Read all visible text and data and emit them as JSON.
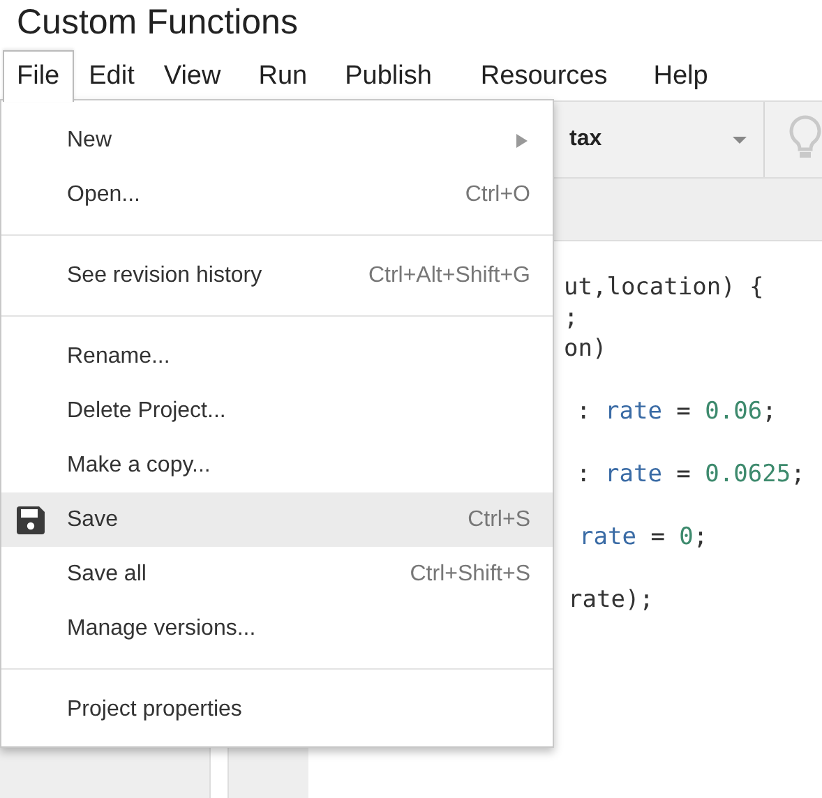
{
  "window": {
    "title": "Custom Functions"
  },
  "menu_bar": [
    {
      "label": "File",
      "selected": true
    },
    {
      "label": "Edit",
      "selected": false
    },
    {
      "label": "View",
      "selected": false
    },
    {
      "label": "Run",
      "selected": false
    },
    {
      "label": "Publish",
      "selected": false
    },
    {
      "label": "Resources",
      "selected": false
    },
    {
      "label": "Help",
      "selected": false
    }
  ],
  "toolbar": {
    "function_select": {
      "value": "tax"
    }
  },
  "code_lines": [
    {
      "tokens": [
        {
          "text": "ut,location) {",
          "kind": "plain"
        }
      ]
    },
    {
      "tokens": [
        {
          "text": ";",
          "kind": "plain"
        }
      ]
    },
    {
      "tokens": [
        {
          "text": "on)",
          "kind": "plain"
        }
      ]
    },
    {
      "tokens": [
        {
          "text": ": ",
          "kind": "plain"
        },
        {
          "text": "rate",
          "kind": "variable"
        },
        {
          "text": " = ",
          "kind": "plain"
        },
        {
          "text": "0.06",
          "kind": "number"
        },
        {
          "text": ";",
          "kind": "plain"
        }
      ]
    },
    {
      "tokens": [
        {
          "text": ": ",
          "kind": "plain"
        },
        {
          "text": "rate",
          "kind": "variable"
        },
        {
          "text": " = ",
          "kind": "plain"
        },
        {
          "text": "0.0625",
          "kind": "number"
        },
        {
          "text": ";",
          "kind": "plain"
        }
      ]
    },
    {
      "tokens": [
        {
          "text": "rate",
          "kind": "variable"
        },
        {
          "text": " = ",
          "kind": "plain"
        },
        {
          "text": "0",
          "kind": "number"
        },
        {
          "text": ";",
          "kind": "plain"
        }
      ]
    },
    {
      "tokens": [
        {
          "text": "rate);",
          "kind": "plain"
        }
      ]
    }
  ],
  "file_menu": {
    "groups": [
      [
        {
          "label": "New",
          "kind": "text",
          "submenu": true,
          "selected": false
        },
        {
          "label": "Open...",
          "shortcut": "Ctrl+O",
          "kind": "text",
          "submenu": false,
          "selected": false
        }
      ],
      [
        {
          "label": "See revision history",
          "shortcut": "Ctrl+Alt+Shift+G",
          "kind": "text",
          "submenu": false,
          "selected": false
        }
      ],
      [
        {
          "label": "Rename...",
          "kind": "text",
          "submenu": false,
          "selected": false
        },
        {
          "label": "Delete Project...",
          "kind": "text",
          "submenu": false,
          "selected": false
        },
        {
          "label": "Make a copy...",
          "kind": "text",
          "submenu": false,
          "selected": false
        },
        {
          "label": "Save",
          "shortcut": "Ctrl+S",
          "kind": "icon",
          "submenu": false,
          "selected": true
        },
        {
          "label": "Save all",
          "shortcut": "Ctrl+Shift+S",
          "kind": "text",
          "submenu": false,
          "selected": false
        },
        {
          "label": "Manage versions...",
          "kind": "text",
          "submenu": false,
          "selected": false
        }
      ],
      [
        {
          "label": "Project properties",
          "kind": "text",
          "submenu": false,
          "selected": false
        }
      ]
    ]
  }
}
